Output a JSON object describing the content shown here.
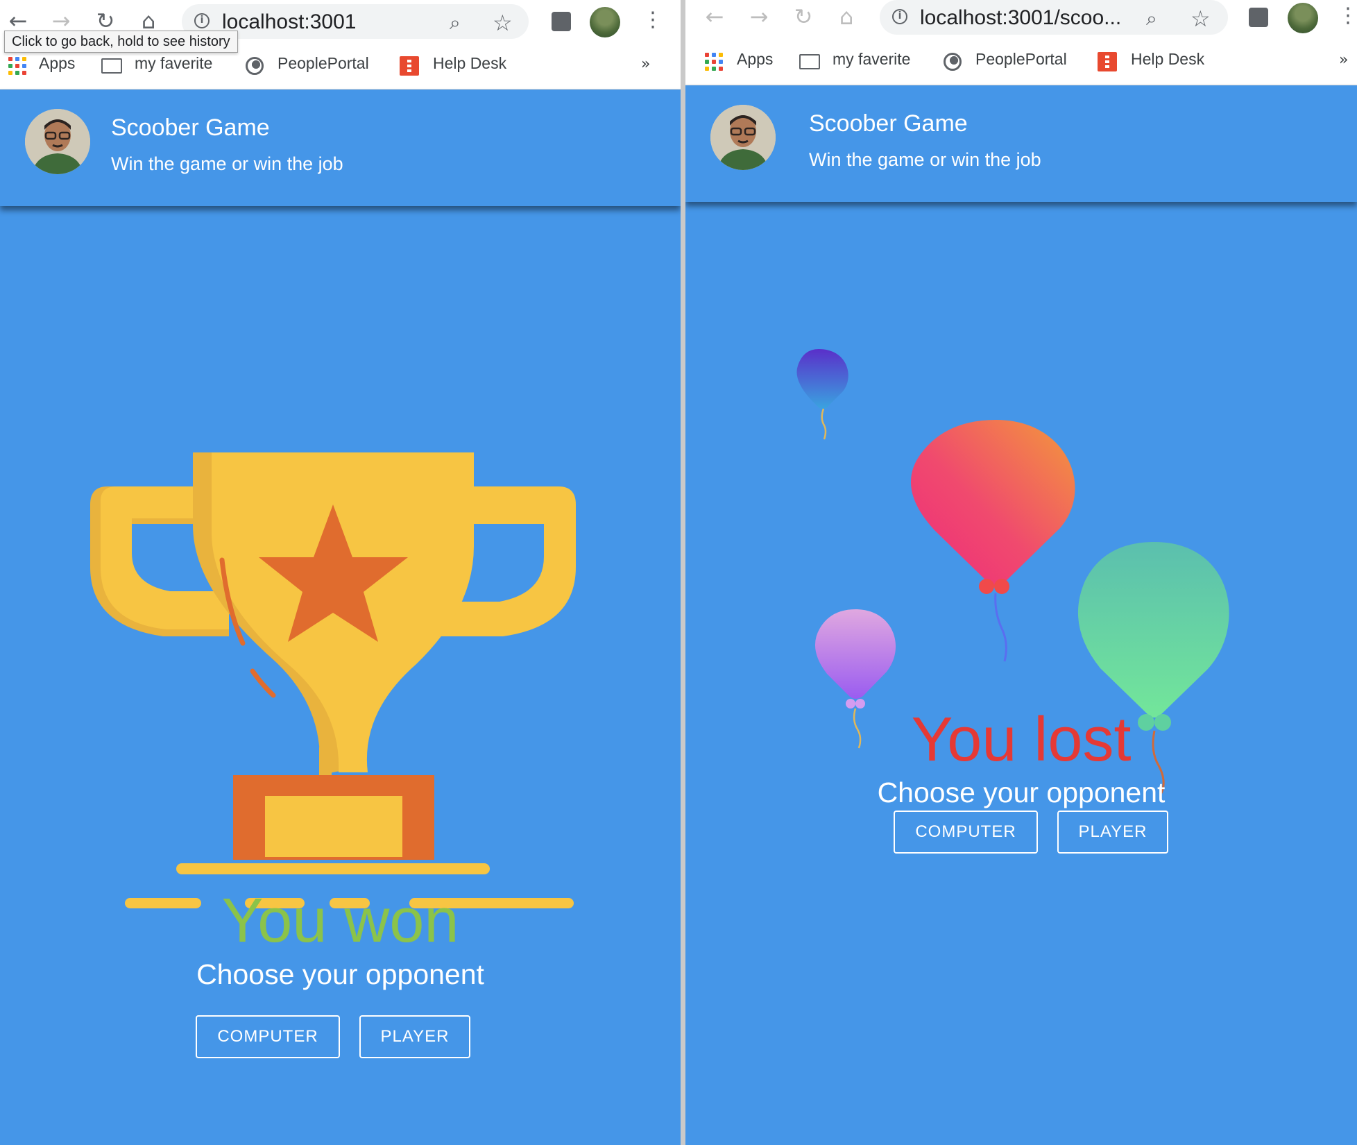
{
  "colors": {
    "app_background": "#4596e8",
    "won_text": "#8bc34a",
    "lost_text": "#e53935",
    "trophy_gold": "#f7c543",
    "trophy_orange": "#e06c2e"
  },
  "browser": {
    "tooltip": "Click to go back, hold to see history",
    "bookmarks": {
      "apps": "Apps",
      "folder": "my faverite",
      "people": "PeoplePortal",
      "help": "Help Desk",
      "more": "»"
    }
  },
  "left": {
    "url": "localhost:3001",
    "header": {
      "title": "Scoober Game",
      "subtitle": "Win the game or win the job"
    },
    "result_text": "You won",
    "choose_text": "Choose your opponent",
    "buttons": {
      "computer": "COMPUTER",
      "player": "PLAYER"
    }
  },
  "right": {
    "url": "localhost:3001/scoo...",
    "header": {
      "title": "Scoober Game",
      "subtitle": "Win the game or win the job"
    },
    "result_text": "You lost",
    "choose_text": "Choose your opponent",
    "buttons": {
      "computer": "COMPUTER",
      "player": "PLAYER"
    }
  },
  "icons": {
    "back": "back-arrow-icon",
    "forward": "forward-arrow-icon",
    "reload": "reload-icon",
    "home": "home-icon",
    "info": "info-icon",
    "zoom": "zoom-icon",
    "star": "bookmark-star-icon",
    "extensions": "puzzle-extension-icon",
    "menu": "three-dot-menu-icon",
    "trophy": "trophy-illustration",
    "balloons": "balloons-illustration"
  }
}
